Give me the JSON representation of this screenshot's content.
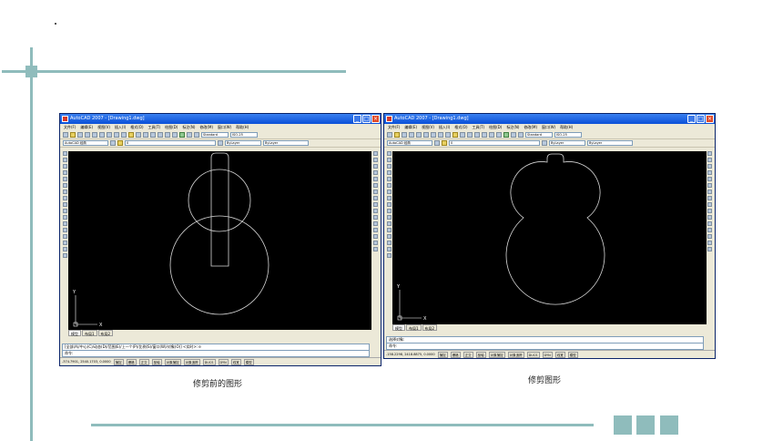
{
  "left_window": {
    "title": "AutoCAD 2007 - [Drawing1.dwg]",
    "menus": [
      "文件(F)",
      "编辑(E)",
      "视图(V)",
      "插入(I)",
      "格式(O)",
      "工具(T)",
      "绘图(D)",
      "标注(N)",
      "修改(M)",
      "窗口(W)",
      "帮助(H)"
    ],
    "workspace": "AutoCAD 经典",
    "text_style": "Standard",
    "dim_style": "ISO-25",
    "layer": "0",
    "layer_prop": "ByLayer",
    "linetype": "ByLayer",
    "tabs": [
      "模型",
      "布局1",
      "布局2"
    ],
    "command_line_1": "[全部(A)/中心(C)/动态(D)/范围(E)/上一个(P)/比例(S)/窗口(W)/对象(O)] <实时>: e",
    "command_line_2": "命令:",
    "coords": "-374.7901, 2540.1703, 0.0000",
    "status_buttons": [
      "捕捉",
      "栅格",
      "正交",
      "极轴",
      "对象捕捉",
      "对象追踪",
      "DUCS",
      "DYN",
      "线宽",
      "模型"
    ],
    "caption": "修剪前的图形"
  },
  "right_window": {
    "title": "AutoCAD 2007 - [Drawing1.dwg]",
    "menus": [
      "文件(F)",
      "编辑(E)",
      "视图(V)",
      "插入(I)",
      "格式(O)",
      "工具(T)",
      "绘图(D)",
      "标注(N)",
      "修改(M)",
      "窗口(W)",
      "帮助(H)"
    ],
    "workspace": "AutoCAD 经典",
    "text_style": "Standard",
    "dim_style": "ISO-25",
    "layer": "0",
    "layer_prop": "ByLayer",
    "linetype": "ByLayer",
    "tabs": [
      "模型",
      "布局1",
      "布局2"
    ],
    "command_line_1": "选择对象:",
    "command_line_2": "命令:",
    "coords": "-158.2298, 2418.8875, 0.0000",
    "status_buttons": [
      "捕捉",
      "栅格",
      "正交",
      "极轴",
      "对象捕捉",
      "对象追踪",
      "DUCS",
      "DYN",
      "线宽",
      "模型"
    ],
    "caption": "修剪图形"
  },
  "colors": {
    "accent": "#8fbcbc",
    "canvas": "#000000",
    "drawing_line": "#d8d8d8"
  }
}
